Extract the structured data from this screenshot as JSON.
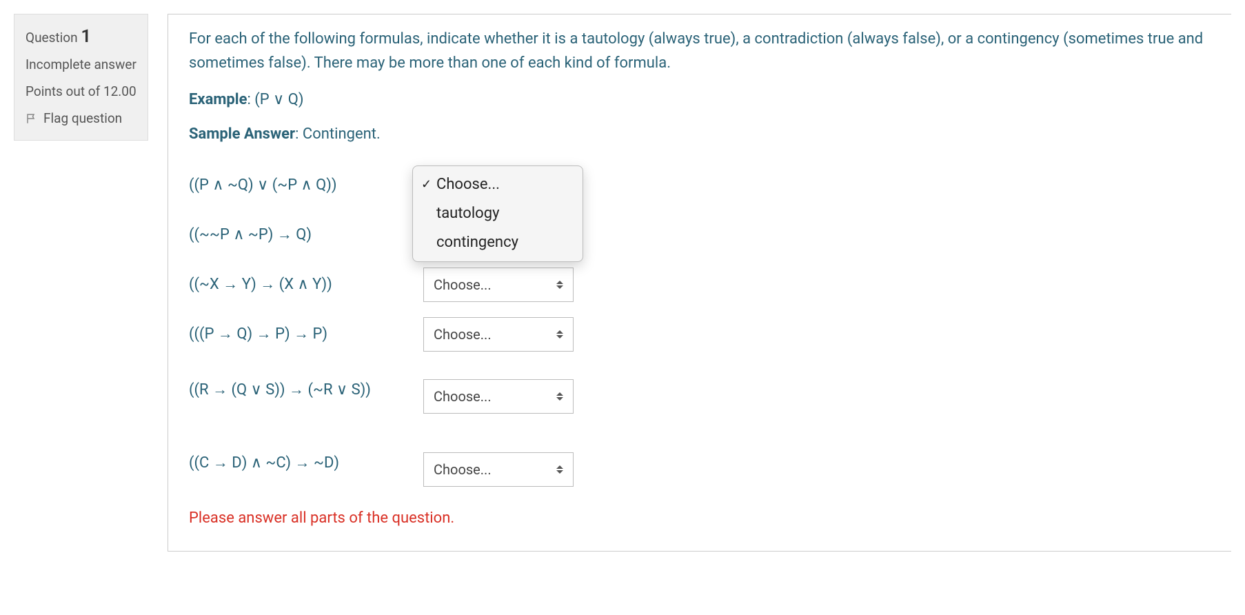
{
  "sidebar": {
    "question_label": "Question",
    "question_number": "1",
    "status": "Incomplete answer",
    "points": "Points out of 12.00",
    "flag_label": "Flag question"
  },
  "content": {
    "intro": "For each of the following formulas, indicate whether it is a tautology (always true), a contradiction (always false), or a contingency (sometimes true and sometimes false). There may be more than one of each kind of formula.",
    "example_label": "Example",
    "example_value": "(P ∨ Q)",
    "sample_label": "Sample Answer",
    "sample_value": "Contingent."
  },
  "formulas": [
    {
      "text": "((P ∧ ~Q) ∨ (~P ∧ Q))",
      "selected": "Choose...",
      "open": true
    },
    {
      "text": "((~~P ∧ ~P) → Q)",
      "selected": "Choose...",
      "open": false
    },
    {
      "text": "((~X → Y) → (X ∧ Y))",
      "selected": "Choose...",
      "open": false
    },
    {
      "text": "(((P → Q) → P) → P)",
      "selected": "Choose...",
      "open": false
    },
    {
      "text": "((R → (Q ∨ S)) → (~R ∨ S))",
      "selected": "Choose...",
      "open": false
    },
    {
      "text": "((C → D) ∧ ~C) → ~D)",
      "selected": "Choose...",
      "open": false
    }
  ],
  "dropdown_options": [
    {
      "label": "Choose...",
      "checked": true
    },
    {
      "label": "tautology",
      "checked": false
    },
    {
      "label": "contingency",
      "checked": false
    }
  ],
  "validation": "Please answer all parts of the question."
}
